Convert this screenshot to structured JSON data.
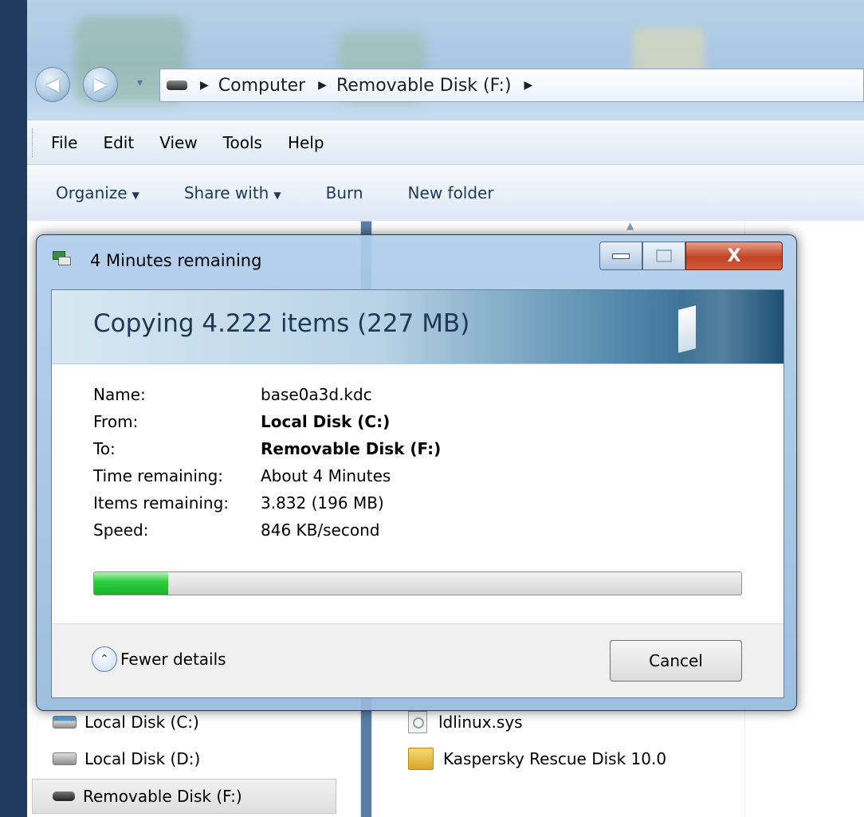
{
  "explorer": {
    "nav": {
      "back_glyph": "◀",
      "forward_glyph": "▶",
      "history_glyph": "▾"
    },
    "breadcrumb": [
      "Computer",
      "Removable Disk (F:)"
    ],
    "menu": [
      "File",
      "Edit",
      "View",
      "Tools",
      "Help"
    ],
    "toolbar": {
      "organize": "Organize",
      "share_with": "Share with",
      "burn": "Burn",
      "new_folder": "New folder"
    },
    "sidebar_items": [
      {
        "label": "Local Disk (C:)",
        "icon": "hard-drive-windows-icon"
      },
      {
        "label": "Local Disk (D:)",
        "icon": "hard-drive-icon"
      },
      {
        "label": "Removable Disk (F:)",
        "icon": "usb-drive-icon",
        "selected": true
      }
    ],
    "files": [
      {
        "name": "ldlinux.sys",
        "icon": "system-file-icon"
      },
      {
        "name": "Kaspersky Rescue Disk 10.0",
        "icon": "folder-icon"
      }
    ]
  },
  "dialog": {
    "title": "4 Minutes remaining",
    "heading": "Copying 4.222 items (227 MB)",
    "close_glyph": "X",
    "details": {
      "name_label": "Name:",
      "name_value": "base0a3d.kdc",
      "from_label": "From:",
      "from_value": "Local Disk (C:)",
      "to_label": "To:",
      "to_value": "Removable Disk (F:)",
      "time_label": "Time remaining:",
      "time_value": "About 4 Minutes",
      "items_label": "Items remaining:",
      "items_value": "3.832 (196 MB)",
      "speed_label": "Speed:",
      "speed_value": "846 KB/second"
    },
    "progress_fraction": 0.115,
    "fewer_details": "Fewer details",
    "fewer_glyph": "⌃",
    "cancel": "Cancel"
  },
  "colors": {
    "progress_green": "#2fcf3f",
    "close_red": "#c24225",
    "heading_blue": "#1e3956"
  }
}
